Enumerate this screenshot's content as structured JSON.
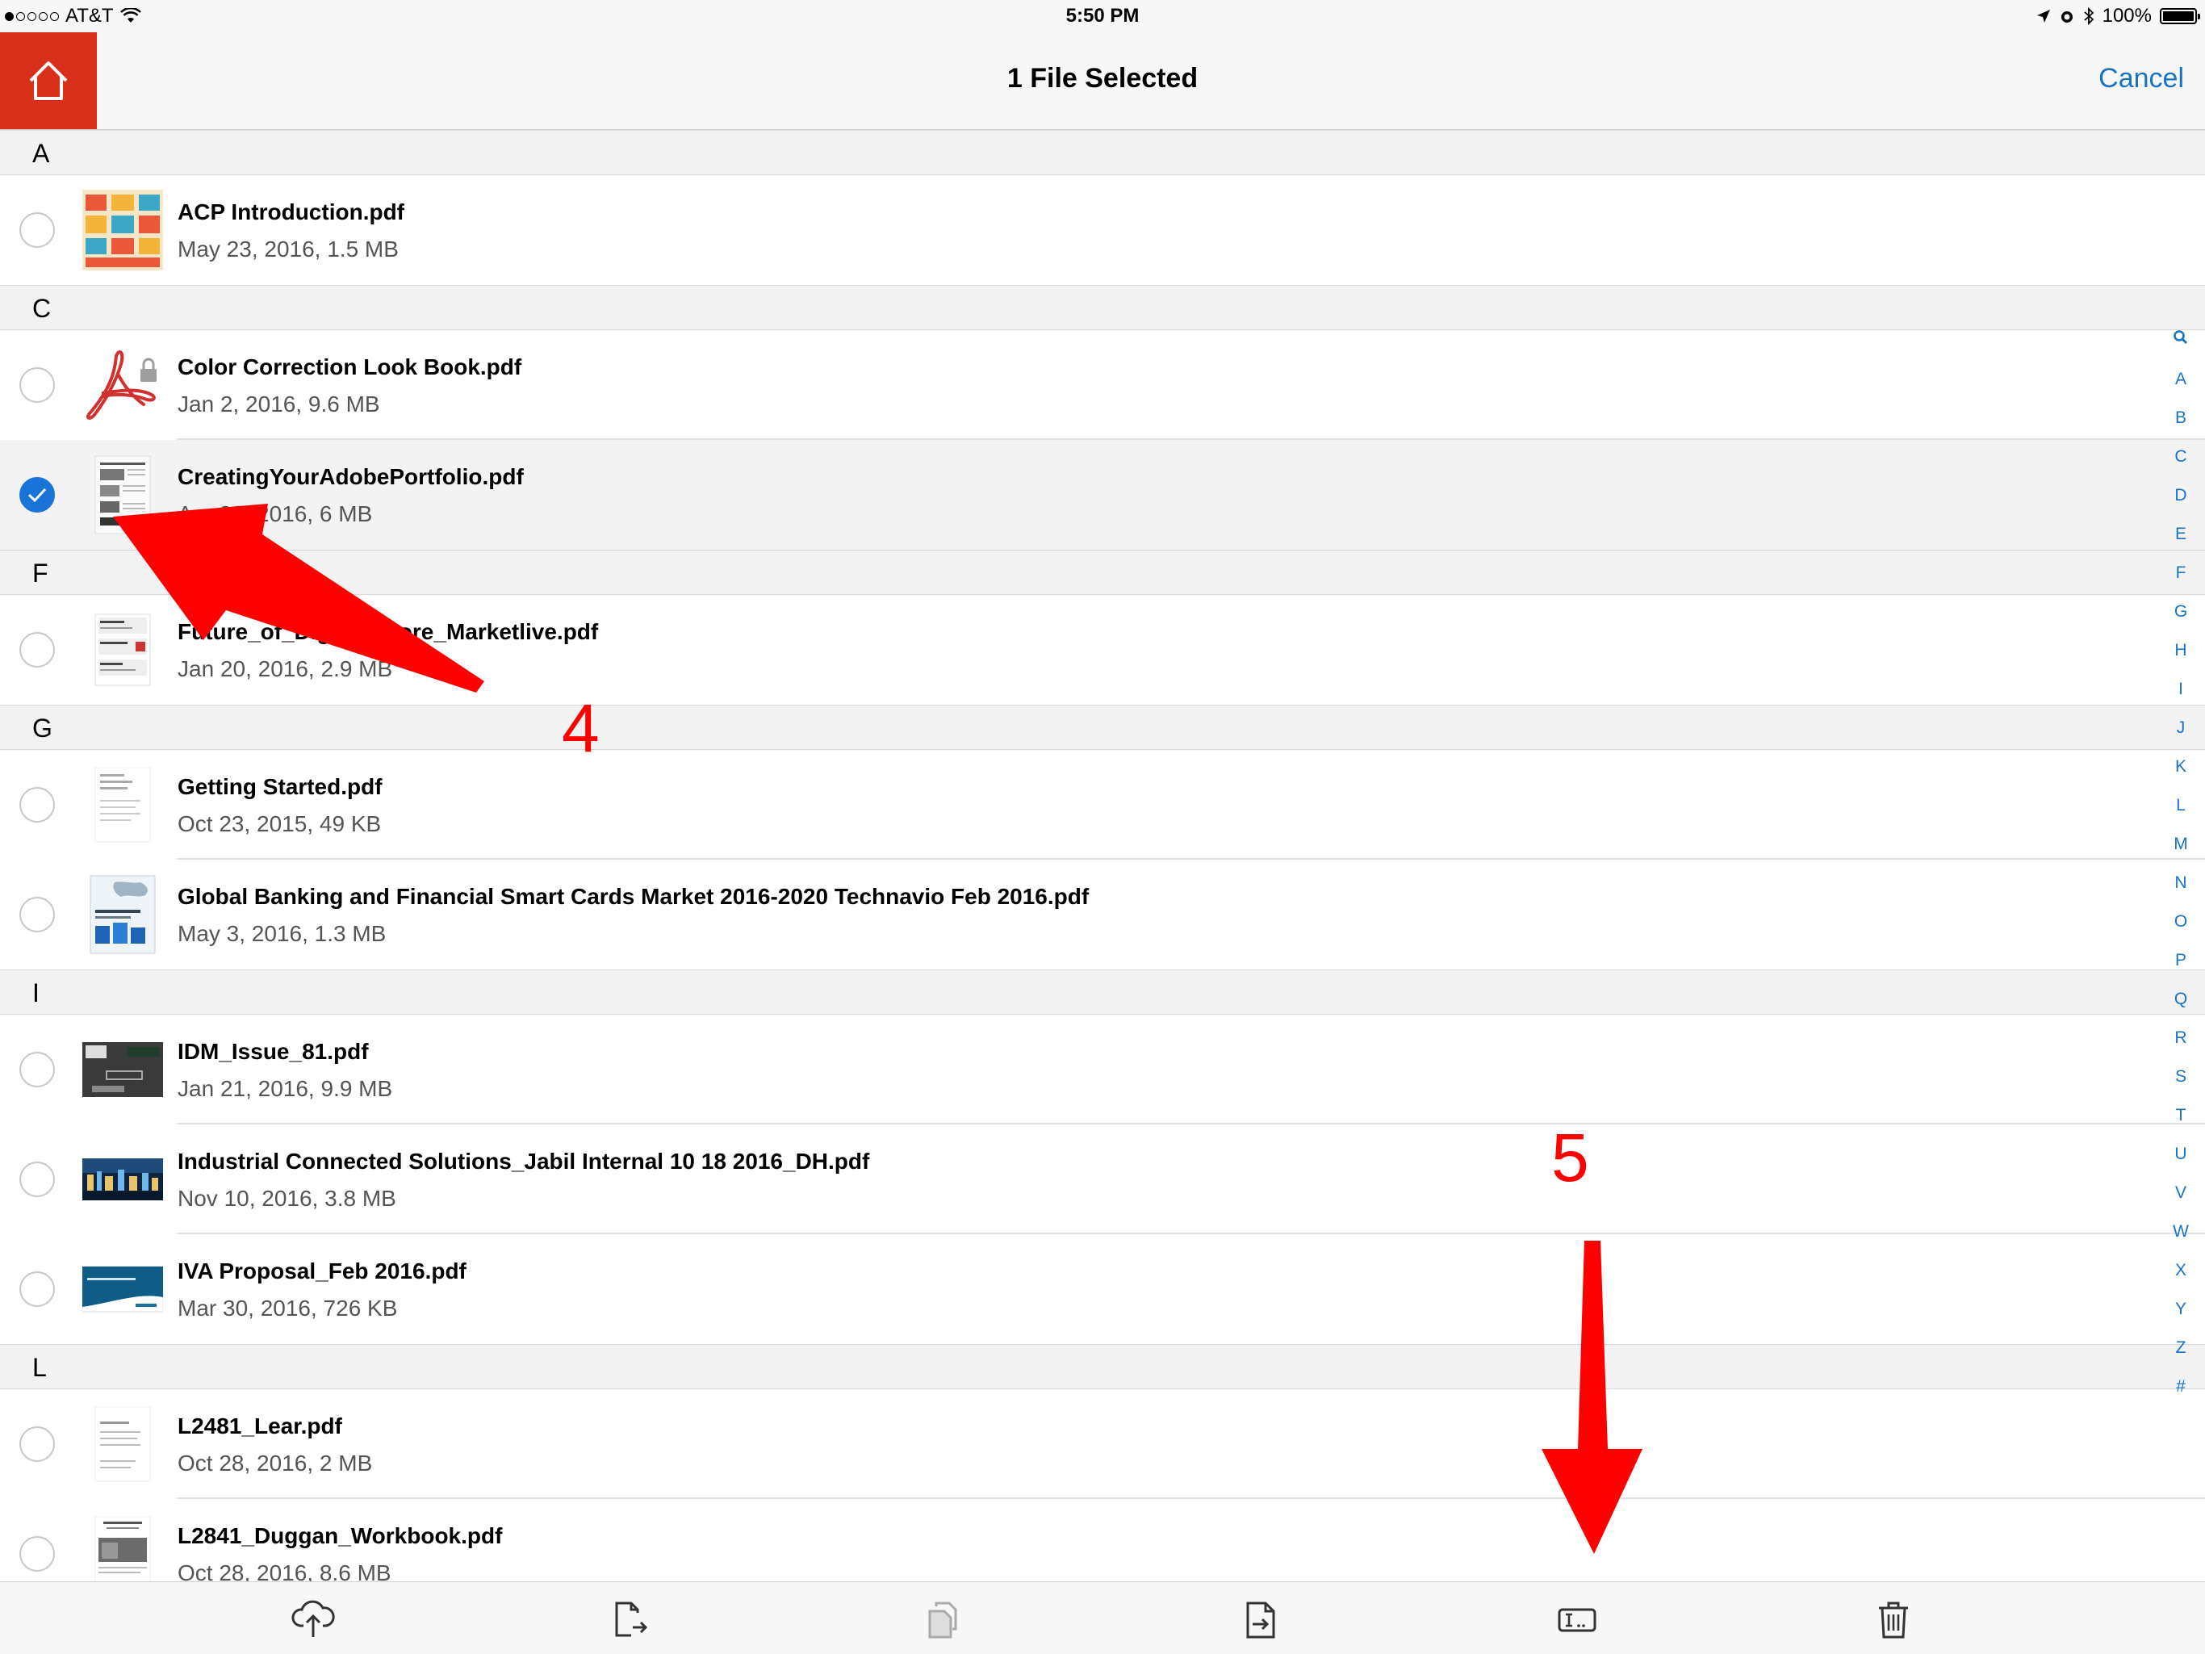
{
  "status_bar": {
    "carrier": "AT&T",
    "time": "5:50 PM",
    "battery": "100%"
  },
  "nav": {
    "title": "1 File Selected",
    "cancel_label": "Cancel"
  },
  "sections": [
    {
      "letter": "A",
      "files": [
        {
          "name": "ACP Introduction.pdf",
          "meta": "May 23, 2016, 1.5 MB",
          "selected": false,
          "thumb": "colorful-grid-thumbnail"
        }
      ]
    },
    {
      "letter": "C",
      "files": [
        {
          "name": "Color Correction Look Book.pdf",
          "meta": "Jan 2, 2016, 9.6 MB",
          "selected": false,
          "thumb": "acrobat-locked-icon"
        },
        {
          "name": "CreatingYourAdobePortfolio.pdf",
          "meta": "Apr 29, 2016, 6 MB",
          "selected": true,
          "thumb": "document-thumbnail"
        }
      ]
    },
    {
      "letter": "F",
      "files": [
        {
          "name": "Future_of_Digital_Store_Marketlive.pdf",
          "meta": "Jan 20, 2016, 2.9 MB",
          "selected": false,
          "thumb": "slides-thumbnail"
        }
      ]
    },
    {
      "letter": "G",
      "files": [
        {
          "name": "Getting Started.pdf",
          "meta": "Oct 23, 2015, 49 KB",
          "selected": false,
          "thumb": "text-thumbnail"
        },
        {
          "name": "Global Banking and Financial Smart Cards Market 2016-2020 Technavio Feb 2016.pdf",
          "meta": "May 3, 2016, 1.3 MB",
          "selected": false,
          "thumb": "report-thumbnail"
        }
      ]
    },
    {
      "letter": "I",
      "files": [
        {
          "name": "IDM_Issue_81.pdf",
          "meta": "Jan 21, 2016, 9.9 MB",
          "selected": false,
          "thumb": "dark-magazine-thumbnail"
        },
        {
          "name": "Industrial Connected Solutions_Jabil Internal 10 18 2016_DH.pdf",
          "meta": "Nov 10, 2016, 3.8 MB",
          "selected": false,
          "thumb": "city-night-thumbnail"
        },
        {
          "name": "IVA Proposal_Feb 2016.pdf",
          "meta": "Mar 30, 2016, 726 KB",
          "selected": false,
          "thumb": "blue-slide-thumbnail"
        }
      ]
    },
    {
      "letter": "L",
      "files": [
        {
          "name": "L2481_Lear.pdf",
          "meta": "Oct 28, 2016, 2 MB",
          "selected": false,
          "thumb": "text-thumbnail"
        },
        {
          "name": "L2841_Duggan_Workbook.pdf",
          "meta": "Oct 28, 2016, 8.6 MB",
          "selected": false,
          "thumb": "workbook-thumbnail"
        }
      ]
    }
  ],
  "index_letters": [
    "A",
    "B",
    "C",
    "D",
    "E",
    "F",
    "G",
    "H",
    "I",
    "J",
    "K",
    "L",
    "M",
    "N",
    "O",
    "P",
    "Q",
    "R",
    "S",
    "T",
    "U",
    "V",
    "W",
    "X",
    "Y",
    "Z",
    "#"
  ],
  "toolbar": [
    "upload-icon",
    "export-icon",
    "copy-icon",
    "move-icon",
    "rename-icon",
    "trash-icon"
  ],
  "annotations": {
    "label_4": "4",
    "label_5": "5",
    "color": "#ff0000"
  },
  "colors": {
    "home": "#d9301c",
    "accent": "#1a73c9",
    "checked": "#1a73d9"
  }
}
